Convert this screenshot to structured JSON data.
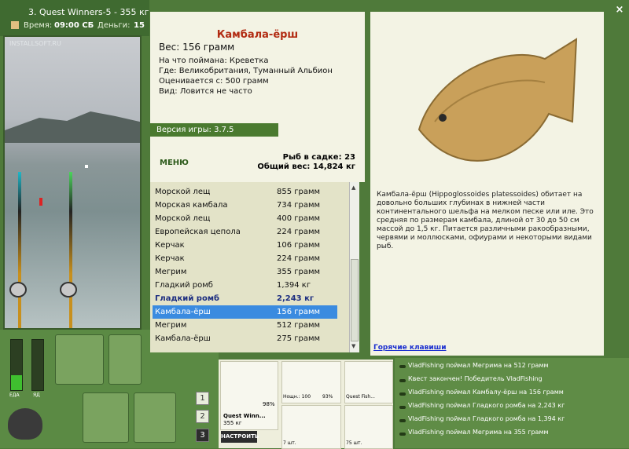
{
  "window": {
    "title": "3. Quest Winners-5 - 355 кг"
  },
  "status": {
    "time_label": "Время:",
    "time_value": "09:00 СБ",
    "money_label": "Деньги:",
    "money_value": "15"
  },
  "scene": {
    "watermark": "INSTALLSOFT.RU"
  },
  "fish": {
    "name": "Камбала-ёрш",
    "weight": "Вес: 156 грамм",
    "bait": "На что поймана: Креветка",
    "location": "Где: Великобритания, Туманный Альбион",
    "value": "Оценивается с: 500 грамм",
    "frequency": "Вид: Ловится не часто",
    "description": "Камбала-ёрш (Hippoglossoides platessoides) обитает на довольно больших глубинах в нижней части континентального шельфа на мелком песке или иле. Это средняя по размерам камбала, длиной от 30 до 50 см массой до 1,5 кг. Питается различными ракообразными, червями и моллюсками, офиурами и некоторыми видами рыб."
  },
  "panel": {
    "version": "Версия игры: 3.7.5",
    "menu_label": "МЕНЮ",
    "catch_count": "Рыб в садке: 23",
    "total_weight": "Общий вес: 14,824 кг",
    "hotkeys": "Горячие клавиши"
  },
  "catch_list": [
    {
      "name": "Морской лещ",
      "weight": "855 грамм",
      "style": "normal"
    },
    {
      "name": "Морская камбала",
      "weight": "734 грамм",
      "style": "normal"
    },
    {
      "name": "Морской лещ",
      "weight": "400 грамм",
      "style": "normal"
    },
    {
      "name": "Европейская цепола",
      "weight": "224 грамм",
      "style": "normal"
    },
    {
      "name": "Керчак",
      "weight": "106 грамм",
      "style": "normal"
    },
    {
      "name": "Керчак",
      "weight": "224 грамм",
      "style": "normal"
    },
    {
      "name": "Мегрим",
      "weight": "355 грамм",
      "style": "normal"
    },
    {
      "name": "Гладкий ромб",
      "weight": "1,394 кг",
      "style": "normal"
    },
    {
      "name": "Гладкий ромб",
      "weight": "2,243 кг",
      "style": "bold"
    },
    {
      "name": "Камбала-ёрш",
      "weight": "156 грамм",
      "style": "selected"
    },
    {
      "name": "Мегрим",
      "weight": "512 грамм",
      "style": "normal"
    },
    {
      "name": "Камбала-ёрш",
      "weight": "275 грамм",
      "style": "normal"
    }
  ],
  "meters": {
    "food_label": "ЕДА",
    "food_level": 0.3,
    "poison_label": "ЯД",
    "poison_level": 0.0
  },
  "tabs": [
    "1",
    "2",
    "3"
  ],
  "tackle": {
    "rod_name": "Quest Winn...",
    "rod_weight": "355 кг",
    "rod_percent": "98%",
    "reel_label": "Нощн.: 100",
    "reel_percent": "93%",
    "line_label": "Quest Fish...",
    "hook_count": "7 шт.",
    "bait_count": "75 шт.",
    "setup_label": "НАСТРОИТЬ"
  },
  "log": [
    "VladFishing поймал Мегрима на 512 грамм",
    "Квест закончен! Победитель VladFishing",
    "VladFishing поймал Камбалу-ёрш на 156 грамм",
    "VladFishing поймал Гладкого ромба на 2,243 кг",
    "VladFishing поймал Гладкого ромба на 1,394 кг",
    "VladFishing поймал Мегрима на 355 грамм"
  ],
  "colors": {
    "green": "#4f7a3a",
    "title_red": "#b22b12",
    "select_blue": "#3a8be0",
    "link_blue": "#1a2ed0"
  },
  "close_label": "×"
}
